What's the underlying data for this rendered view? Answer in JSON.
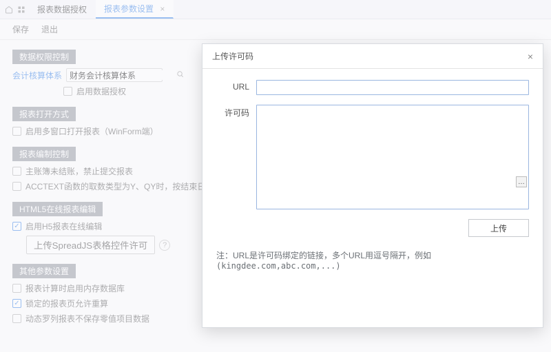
{
  "tabs": {
    "home_icon": "home",
    "grid_icon": "grid",
    "items": [
      {
        "label": "报表数据授权",
        "active": false
      },
      {
        "label": "报表参数设置",
        "active": true
      }
    ]
  },
  "actions": {
    "save": "保存",
    "exit": "退出"
  },
  "sections": {
    "dataPerm": {
      "title": "数据权限控制",
      "fieldLabel": "会计核算体系",
      "selectValue": "财务会计核算体系",
      "enableLabel": "启用数据授权"
    },
    "openMode": {
      "title": "报表打开方式",
      "multiWindowLabel": "启用多窗口打开报表（WinForm端）"
    },
    "compileCtrl": {
      "title": "报表编制控制",
      "opt1": "主账簿未结账，禁止提交报表",
      "opt2": "ACCTEXT函数的取数类型为Y、QY时，按结束日期来计算"
    },
    "html5": {
      "title": "HTML5在线报表编辑",
      "enableH5": "启用H5报表在线编辑",
      "uploadCtrl": "上传SpreadJS表格控件许可"
    },
    "other": {
      "title": "其他参数设置",
      "opt1": "报表计算时启用内存数据库",
      "opt2": "锁定的报表页允许重算",
      "opt3": "动态罗列报表不保存零值项目数据"
    }
  },
  "modal": {
    "title": "上传许可码",
    "urlLabel": "URL",
    "urlValue": "",
    "codeLabel": "许可码",
    "codeValue": "",
    "uploadBtn": "上传",
    "note_prefix": "注：URL是许可码绑定的链接，多个URL用逗号隔开，例如",
    "note_example": "(kingdee.com,abc.com,...)"
  }
}
